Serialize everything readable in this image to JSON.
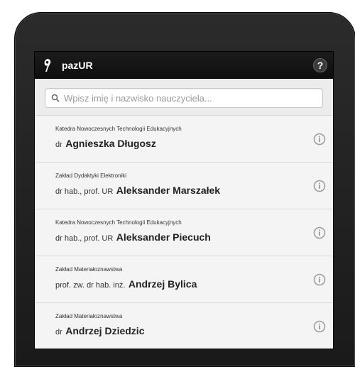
{
  "app": {
    "title": "pazUR",
    "help_label": "?"
  },
  "search": {
    "placeholder": "Wpisz imię i nazwisko nauczyciela..."
  },
  "teachers": [
    {
      "department": "Katedra Nowoczesnych Technologii Edukacyjnych",
      "title": "dr",
      "name": "Agnieszka Długosz"
    },
    {
      "department": "Zakład Dydaktyki Elektroniki",
      "title": "dr hab., prof. UR",
      "name": "Aleksander Marszałek"
    },
    {
      "department": "Katedra Nowoczesnych Technologii Edukacyjnych",
      "title": "dr hab., prof. UR",
      "name": "Aleksander Piecuch"
    },
    {
      "department": "Zakład Materiałoznawstwa",
      "title": "prof. zw. dr hab. inż.",
      "name": "Andrzej Bylica"
    },
    {
      "department": "Zakład Materiałoznawstwa",
      "title": "dr",
      "name": "Andrzej Dziedzic"
    }
  ],
  "icons": {
    "logo": "quill-logo-icon",
    "help": "question-icon",
    "search": "search-icon",
    "info": "info-icon"
  },
  "colors": {
    "appbar": "#111111",
    "bezel": "#222222",
    "list_bg": "#f4f4f4"
  }
}
